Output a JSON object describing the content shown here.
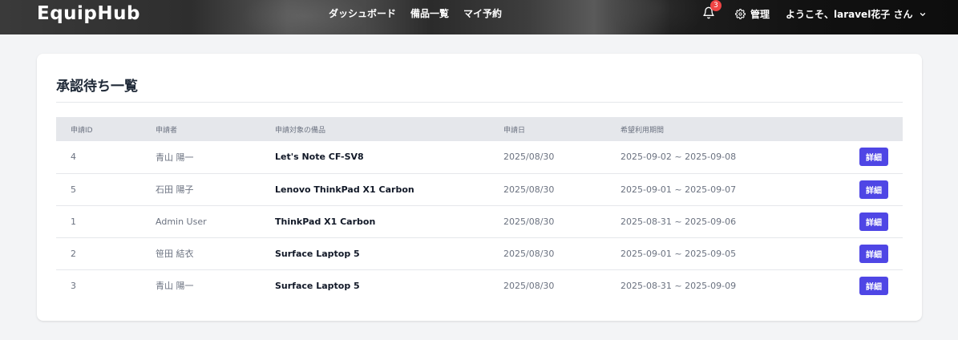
{
  "header": {
    "logo": "EquipHub",
    "nav": [
      {
        "label": "ダッシュボード"
      },
      {
        "label": "備品一覧"
      },
      {
        "label": "マイ予約"
      }
    ],
    "notification_count": "3",
    "admin_label": "管理",
    "user_greeting": "ようこそ、laravel花子 さん"
  },
  "main": {
    "title": "承認待ち一覧",
    "columns": [
      "申請ID",
      "申請者",
      "申請対象の備品",
      "申請日",
      "希望利用期間",
      ""
    ],
    "rows": [
      {
        "id": "4",
        "applicant": "青山 陽一",
        "item": "Let's Note CF-SV8",
        "date": "2025/08/30",
        "period": "2025-09-02 ~ 2025-09-08",
        "action": "詳細"
      },
      {
        "id": "5",
        "applicant": "石田 陽子",
        "item": "Lenovo ThinkPad X1 Carbon",
        "date": "2025/08/30",
        "period": "2025-09-01 ~ 2025-09-07",
        "action": "詳細"
      },
      {
        "id": "1",
        "applicant": "Admin User",
        "item": "ThinkPad X1 Carbon",
        "date": "2025/08/30",
        "period": "2025-08-31 ~ 2025-09-06",
        "action": "詳細"
      },
      {
        "id": "2",
        "applicant": "笹田 結衣",
        "item": "Surface Laptop 5",
        "date": "2025/08/30",
        "period": "2025-09-01 ~ 2025-09-05",
        "action": "詳細"
      },
      {
        "id": "3",
        "applicant": "青山 陽一",
        "item": "Surface Laptop 5",
        "date": "2025/08/30",
        "period": "2025-08-31 ~ 2025-09-09",
        "action": "詳細"
      }
    ]
  },
  "colors": {
    "accent": "#4f46e5",
    "badge": "#ef4444",
    "header_bg": "#2b2b2b",
    "page_bg": "#f3f4f6"
  },
  "icons": {
    "notification": "bell-icon",
    "admin": "gear-icon",
    "user_menu": "chevron-down-icon"
  }
}
